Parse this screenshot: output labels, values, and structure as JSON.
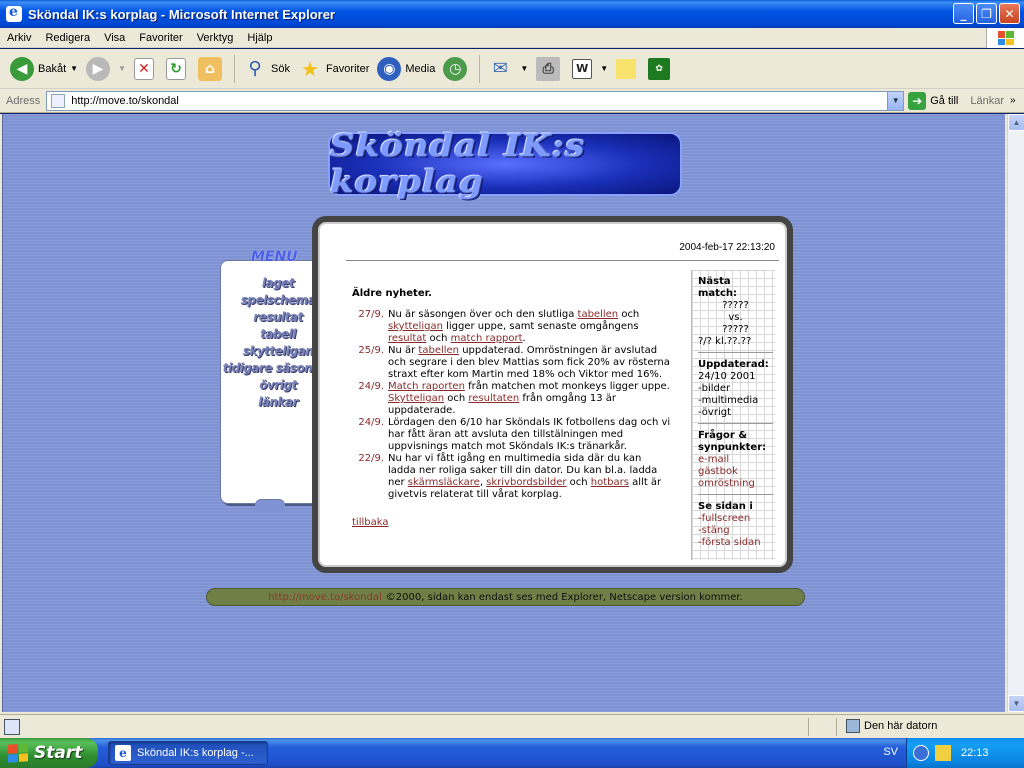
{
  "window": {
    "title": "Sköndal IK:s korplag - Microsoft Internet Explorer"
  },
  "menu": [
    "Arkiv",
    "Redigera",
    "Visa",
    "Favoriter",
    "Verktyg",
    "Hjälp"
  ],
  "toolbar": {
    "back": "Bakåt",
    "search": "Sök",
    "favorites": "Favoriter",
    "media": "Media"
  },
  "address": {
    "label": "Adress",
    "url": "http://move.to/skondal",
    "go": "Gå till",
    "links": "Länkar"
  },
  "site": {
    "banner": "Sköndal IK:s korplag",
    "timestamp": "2004-feb-17 22:13:20",
    "menu_title": "MENU",
    "menu_items": [
      "laget",
      "spelschema",
      "resultat",
      "tabell",
      "skytteligan",
      "tidigare säsonger",
      "övrigt",
      "länkar"
    ],
    "news_heading": "Äldre nyheter.",
    "news": [
      {
        "date": "27/9.",
        "parts": [
          "Nu är säsongen över och den slutliga ",
          "tabellen",
          " och ",
          "skytteligan",
          " ligger uppe, samt senaste omgångens ",
          "resultat",
          " och ",
          "match rapport",
          "."
        ]
      },
      {
        "date": "25/9.",
        "parts": [
          "Nu är ",
          "tabellen",
          " uppdaterad. Omröstningen är avslutad och segrare i den blev Mattias som fick 20% av rösterna straxt efter kom Martin med 18% och Viktor med 16%."
        ]
      },
      {
        "date": "24/9.",
        "parts": [
          "",
          "Match raporten",
          " från matchen mot monkeys ligger uppe. ",
          "Skytteligan",
          " och ",
          "resultaten",
          " från omgång 13 är uppdaterade."
        ]
      },
      {
        "date": "24/9.",
        "parts": [
          "Lördagen den 6/10 har Sköndals IK fotbollens dag och vi har fått äran att avsluta den tillstälningen med uppvisnings match mot Sköndals IK:s tränarkår."
        ]
      },
      {
        "date": "22/9.",
        "parts": [
          "Nu har vi fått igång en multimedia sida där du kan ladda ner roliga saker till din dator. Du kan bl.a. ladda ner ",
          "skärmsläckare",
          ", ",
          "skrivbordsbilder",
          " och ",
          "hotbars",
          " allt är givetvis relaterat till vårat korplag."
        ]
      }
    ],
    "back_link": "tillbaka",
    "sidebar": {
      "next_match_label": "Nästa match:",
      "next_match_home": "?????",
      "next_match_vs": "vs.",
      "next_match_away": "?????",
      "next_match_time": "?/? kl.??.??",
      "updated_label": "Uppdaterad:",
      "updated_date": "24/10 2001",
      "updated_items": [
        "-bilder",
        "-multimedia",
        "-övrigt"
      ],
      "questions_label": "Frågor & synpunkter:",
      "questions_links": [
        "e-mail",
        "gästbok",
        "omröstning"
      ],
      "view_label": "Se sidan i",
      "view_links": [
        "-fullscreen",
        "-stäng",
        "-första sidan"
      ]
    },
    "footer_url": "http://move.to/skondal",
    "footer_text": "©2000, sidan kan endast ses med Explorer, Netscape version kommer."
  },
  "statusbar": {
    "zone": "Den här datorn"
  },
  "taskbar": {
    "start": "Start",
    "task": "Sköndal IK:s korplag -...",
    "lang": "SV",
    "clock": "22:13"
  },
  "colors": {
    "link": "#8a2a2a",
    "page_bg": "#7e92d4",
    "footer_bar": "#6f7f45"
  }
}
